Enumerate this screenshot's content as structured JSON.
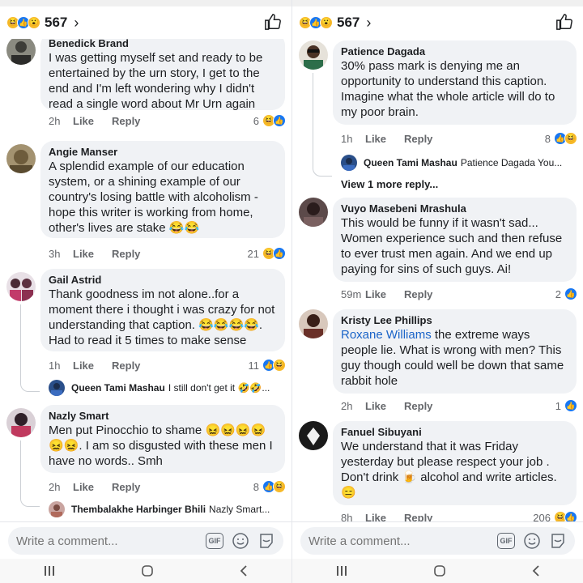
{
  "left": {
    "header": {
      "count": "567"
    },
    "comments": [
      {
        "name": "Benedick Brand",
        "text": "I was getting myself set and ready to be entertained by the urn story, I get to the end and I'm left wondering why I didn't read a single word about Mr Urn again",
        "time": "2h",
        "like": "Like",
        "reply": "Reply",
        "reactions": "6"
      },
      {
        "name": "Angie Manser",
        "text": "A splendid example of our education system, or a shining example of our country's losing battle with alcoholism - hope this writer is working from home, other's lives are stake 😂😂",
        "time": "3h",
        "like": "Like",
        "reply": "Reply",
        "reactions": "21"
      },
      {
        "name": "Gail Astrid",
        "text": "Thank goodness im not alone..for a moment there i thought i was crazy for not understanding that caption. 😂😂😂😂. Had to read it 5 times to make sense",
        "time": "1h",
        "like": "Like",
        "reply": "Reply",
        "reactions": "11",
        "reply_preview": {
          "name": "Queen Tami Mashau",
          "text": "I still don't get it 🤣🤣..."
        }
      },
      {
        "name": "Nazly Smart",
        "text": "Men put Pinocchio to shame 😖😖😖😖😖😖. I am so disgusted with these men I have no words.. Smh",
        "time": "2h",
        "like": "Like",
        "reply": "Reply",
        "reactions": "8",
        "reply_preview": {
          "name": "Thembalakhe Harbinger Bhili",
          "text": "Nazly Smart..."
        }
      }
    ],
    "composer": {
      "placeholder": "Write a comment..."
    },
    "gif_label": "GIF"
  },
  "right": {
    "header": {
      "count": "567"
    },
    "comments": [
      {
        "name": "Patience Dagada",
        "text": "30% pass mark is denying me an opportunity to understand this caption. Imagine what the whole article will do to my poor brain.",
        "time": "1h",
        "like": "Like",
        "reply": "Reply",
        "reactions": "8",
        "reply_preview": {
          "name": "Queen Tami Mashau",
          "text": "Patience Dagada You..."
        },
        "view_more": "View 1 more reply..."
      },
      {
        "name": "Vuyo Masebeni Mrashula",
        "text": "This would be funny if it wasn't sad... Women experience such and then refuse to ever trust men again. And we end up paying for sins of such guys. Ai!",
        "time": "59m",
        "like": "Like",
        "reply": "Reply",
        "reactions": "2"
      },
      {
        "name": "Kristy Lee Phillips",
        "mention": "Roxane Williams",
        "text": " the extreme ways people lie. What is wrong with men? This guy though could well be down that same rabbit hole",
        "time": "2h",
        "like": "Like",
        "reply": "Reply",
        "reactions": "1"
      },
      {
        "name": "Fanuel Sibuyani",
        "text": "We understand that it was Friday yesterday but please respect your job . Don't drink 🍺 alcohol and write articles. 😑",
        "time": "8h",
        "like": "Like",
        "reply": "Reply",
        "reactions": "206"
      }
    ],
    "composer": {
      "placeholder": "Write a comment..."
    },
    "gif_label": "GIF"
  },
  "colors": {
    "like_blue": "#1877f2",
    "haha_yellow": "#f7b928",
    "bubble_bg": "#f0f2f5",
    "meta_gray": "#65676b",
    "mention_blue": "#1a64c8"
  },
  "icons": [
    "haha-icon",
    "like-icon",
    "wow-icon",
    "chevron-right-icon",
    "thumbs-up-icon",
    "gif-icon",
    "emoji-icon",
    "sticker-icon",
    "recents-icon",
    "home-icon",
    "back-icon"
  ]
}
